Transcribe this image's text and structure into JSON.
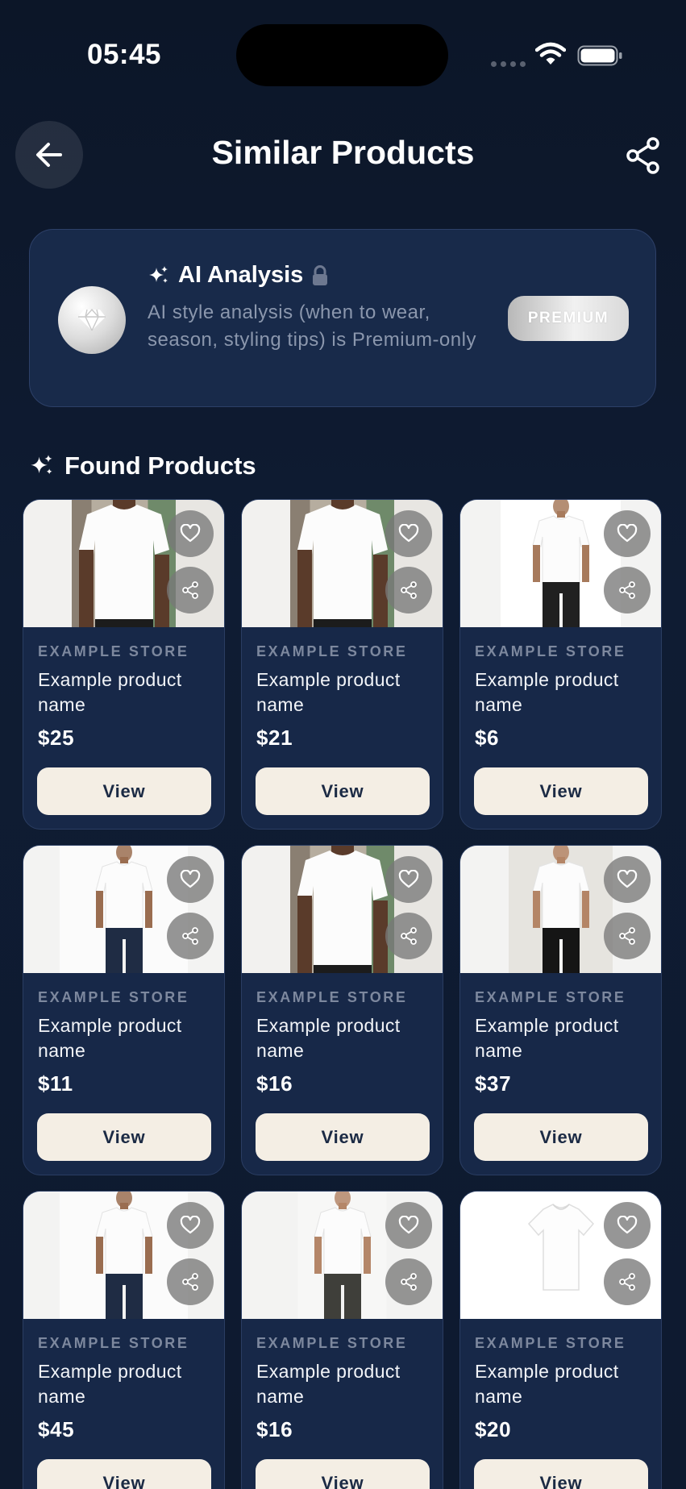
{
  "status_bar": {
    "time": "05:45"
  },
  "header": {
    "title": "Similar Products"
  },
  "ai_card": {
    "title": "AI Analysis",
    "description": "AI style analysis (when to wear, season, styling tips) is Premium-only",
    "badge": "PREMIUM"
  },
  "section": {
    "title": "Found Products"
  },
  "products": [
    {
      "store": "EXAMPLE STORE",
      "name": "Example product name",
      "price": "$25",
      "view_label": "View",
      "photo": "warm-bg-shirt"
    },
    {
      "store": "EXAMPLE STORE",
      "name": "Example product name",
      "price": "$21",
      "view_label": "View",
      "photo": "warm-bg-shirt"
    },
    {
      "store": "EXAMPLE STORE",
      "name": "Example product name",
      "price": "$6",
      "view_label": "View",
      "photo": "full-body-black-pants"
    },
    {
      "store": "EXAMPLE STORE",
      "name": "Example product name",
      "price": "$11",
      "view_label": "View",
      "photo": "full-body-jeans"
    },
    {
      "store": "EXAMPLE STORE",
      "name": "Example product name",
      "price": "$16",
      "view_label": "View",
      "photo": "warm-bg-shirt"
    },
    {
      "store": "EXAMPLE STORE",
      "name": "Example product name",
      "price": "$37",
      "view_label": "View",
      "photo": "full-body-shorts"
    },
    {
      "store": "EXAMPLE STORE",
      "name": "Example product name",
      "price": "$45",
      "view_label": "View",
      "photo": "full-body-jeans"
    },
    {
      "store": "EXAMPLE STORE",
      "name": "Example product name",
      "price": "$16",
      "view_label": "View",
      "photo": "full-body-grey-pants"
    },
    {
      "store": "EXAMPLE STORE",
      "name": "Example product name",
      "price": "$20",
      "view_label": "View",
      "photo": "flat-tee"
    }
  ],
  "icons": {
    "back": "arrow-left-icon",
    "share": "share-icon",
    "gem": "diamond-icon",
    "sparkle": "sparkle-icon",
    "lock": "lock-icon",
    "favorite": "heart-icon"
  },
  "colors": {
    "background": "#0e1a2e",
    "card": "#172848",
    "card_border": "#2a3d62",
    "view_button": "#f4eee4",
    "muted_text": "#8b97ad"
  }
}
